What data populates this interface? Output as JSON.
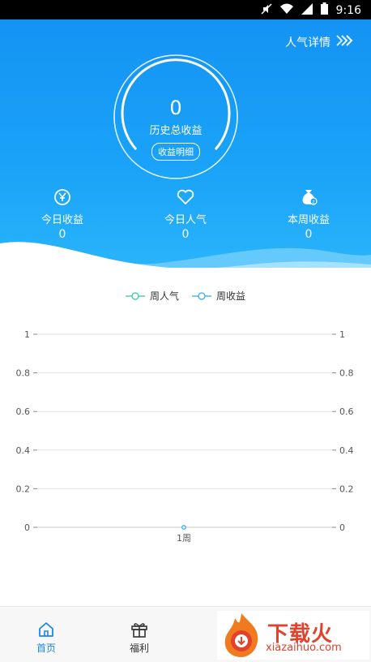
{
  "statusbar": {
    "time": "9:16",
    "icons": [
      "mute-icon",
      "wifi-icon",
      "signal-icon",
      "battery-icon"
    ]
  },
  "hero": {
    "detail_link": "人气详情",
    "total_value": "0",
    "total_label": "历史总收益",
    "detail_button": "收益明细",
    "stats": [
      {
        "icon": "yuan-coin-icon",
        "label": "今日收益",
        "value": "0"
      },
      {
        "icon": "heart-icon",
        "label": "今日人气",
        "value": "0"
      },
      {
        "icon": "money-bag-icon",
        "label": "本周收益",
        "value": "0"
      }
    ]
  },
  "chart_data": {
    "type": "line",
    "x": [
      "1周"
    ],
    "series": [
      {
        "name": "周人气",
        "values": [
          0
        ],
        "color": "#2ec7a8"
      },
      {
        "name": "周收益",
        "values": [
          0
        ],
        "color": "#2aa6f2"
      }
    ],
    "y_ticks_left": [
      "1",
      "0.8",
      "0.6",
      "0.4",
      "0.2",
      "0"
    ],
    "y_ticks_right": [
      "1",
      "0.8",
      "0.6",
      "0.4",
      "0.2",
      "0"
    ],
    "ylim": [
      0,
      1
    ],
    "grid": true,
    "legend": "top-center"
  },
  "tabbar": {
    "tabs": [
      {
        "label": "首页",
        "icon": "home-icon",
        "active": true
      },
      {
        "label": "福利",
        "icon": "gift-icon",
        "active": false
      }
    ]
  },
  "watermark": {
    "title": "下载火",
    "subtitle": "xiazaihuo.com"
  },
  "colors": {
    "primary": "#1493f4",
    "accent_green": "#2ec7a8",
    "accent_blue": "#2aa6f2"
  }
}
